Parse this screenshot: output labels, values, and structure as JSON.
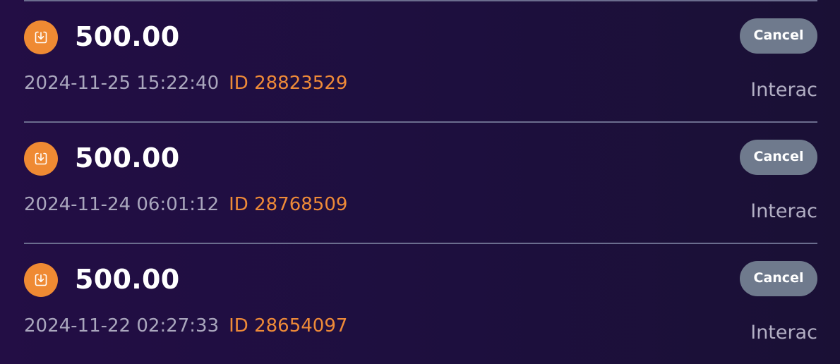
{
  "transactions": [
    {
      "amount": "500.00",
      "datetime": "2024-11-25 15:22:40",
      "id": "ID 28823529",
      "cancel_label": "Cancel",
      "method": "Interac",
      "icon": "deposit-download-icon"
    },
    {
      "amount": "500.00",
      "datetime": "2024-11-24 06:01:12",
      "id": "ID 28768509",
      "cancel_label": "Cancel",
      "method": "Interac",
      "icon": "deposit-download-icon"
    },
    {
      "amount": "500.00",
      "datetime": "2024-11-22 02:27:33",
      "id": "ID 28654097",
      "cancel_label": "Cancel",
      "method": "Interac",
      "icon": "deposit-download-icon"
    }
  ],
  "colors": {
    "background": "#1f0f40",
    "accent_orange": "#ef8a33",
    "cancel_button": "#6f7a8d",
    "muted_text": "#a9a6bd",
    "divider": "#6b6d8e"
  }
}
